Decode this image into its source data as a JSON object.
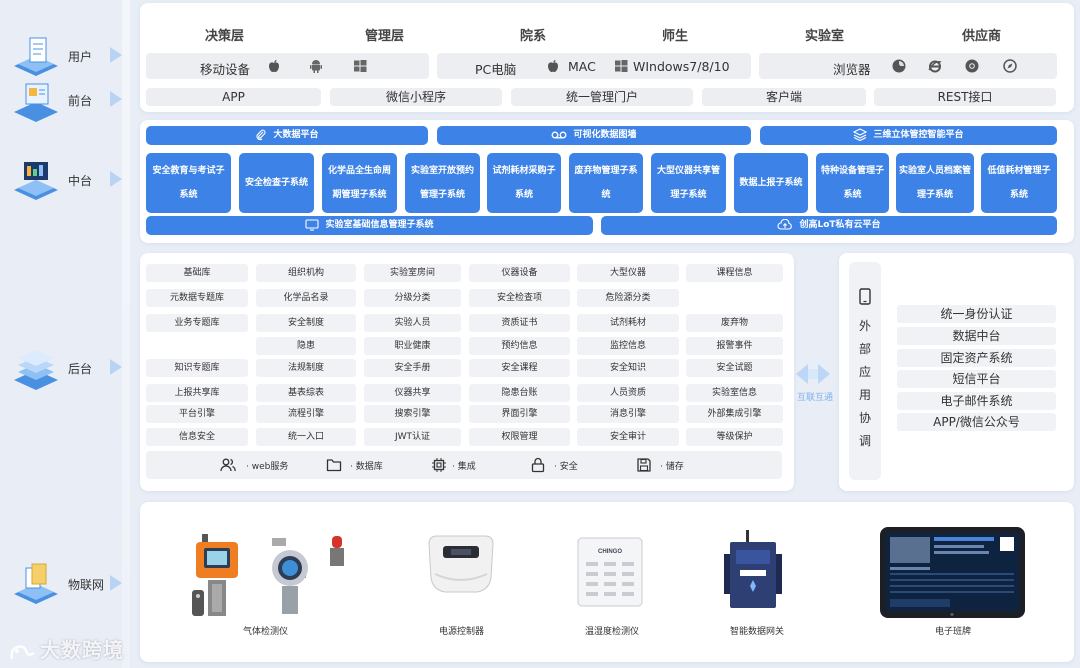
{
  "layers": {
    "user": "用户",
    "front": "前台",
    "middle": "中台",
    "back": "后台",
    "iot": "物联网"
  },
  "roles": [
    "决策层",
    "管理层",
    "院系",
    "师生",
    "实验室",
    "供应商"
  ],
  "devices": {
    "mobile": "移动设备",
    "pc": "PC电脑",
    "mac": "MAC",
    "windows": "WIndows7/8/10",
    "browser": "浏览器"
  },
  "front_items": [
    "APP",
    "微信小程序",
    "统一管理门户",
    "客户端",
    "REST接口"
  ],
  "middle": {
    "top_bars": [
      "大数据平台",
      "可视化数据图墙",
      "三维立体管控智能平台"
    ],
    "subsystems": [
      "安全教育与考试子系统",
      "安全检查子系统",
      "化学品全生命周期管理子系统",
      "实验室开放预约管理子系统",
      "试剂耗材采购子系统",
      "废弃物管理子系统",
      "大型仪器共享管理子系统",
      "数据上报子系统",
      "特种设备管理子系统",
      "实验室人员档案管理子系统",
      "低值耗材管理子系统"
    ],
    "bottom_bars": [
      "实验室基础信息管理子系统",
      "创高LoT私有云平台"
    ]
  },
  "backend": {
    "col1": [
      "基础库",
      "元数据专题库",
      "业务专题库",
      "",
      "知识专题库",
      "上报共享库",
      "平台引擎",
      "信息安全"
    ],
    "col2": [
      "组织机构",
      "化学品名录",
      "安全制度",
      "隐患",
      "法规制度",
      "基表综表",
      "流程引擎",
      "统一入口"
    ],
    "col3": [
      "实验室房间",
      "分级分类",
      "实验人员",
      "职业健康",
      "安全手册",
      "仪器共享",
      "搜索引擎",
      "JWT认证"
    ],
    "col4": [
      "仪器设备",
      "安全检查项",
      "资质证书",
      "预约信息",
      "安全课程",
      "隐患台账",
      "界面引擎",
      "权限管理"
    ],
    "col5": [
      "大型仪器",
      "危险源分类",
      "试剂耗材",
      "监控信息",
      "安全知识",
      "人员资质",
      "消息引擎",
      "安全审计"
    ],
    "col6": [
      "课程信息",
      "",
      "废弃物",
      "报警事件",
      "安全试题",
      "实验室信息",
      "外部集成引擎",
      "等级保护"
    ],
    "services": [
      "· web服务",
      "· 数据库",
      "· 集成",
      "· 安全",
      "· 储存"
    ]
  },
  "link_label": "互联互通",
  "external": {
    "title_chars": [
      "外",
      "部",
      "应",
      "用",
      "协",
      "调"
    ],
    "items": [
      "统一身份认证",
      "数据中台",
      "固定资产系统",
      "短信平台",
      "电子邮件系统",
      "APP/微信公众号"
    ]
  },
  "iot_devices": [
    "气体检测仪",
    "电源控制器",
    "温湿度检测仪",
    "智能数据网关",
    "电子班牌"
  ],
  "sensor_brand": "CHINGO",
  "watermark": "大数跨境",
  "colors": {
    "accent": "#3d82e6",
    "panel": "#ffffff",
    "chip": "#f1f2f5",
    "background": "#e9eef6"
  }
}
